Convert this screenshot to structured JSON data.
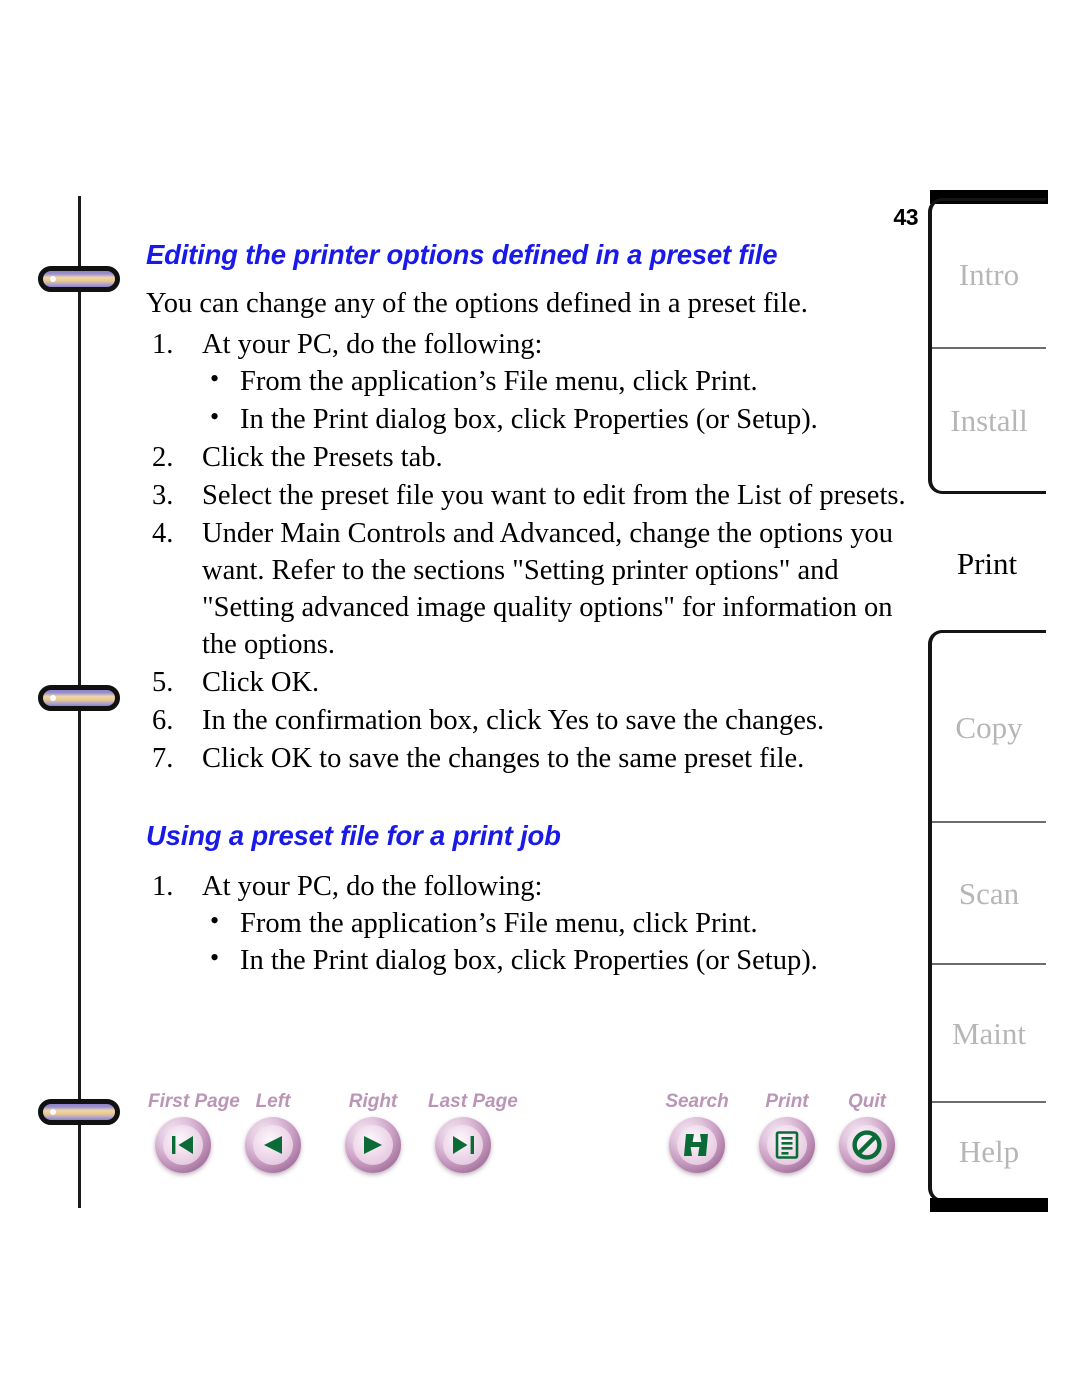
{
  "page": {
    "number": "43"
  },
  "content": {
    "heading_editing": "Editing the printer options defined in a preset file",
    "intro_editing": "You can change any of the options defined in a preset file.",
    "steps_editing": [
      {
        "num": "1.",
        "text": "At your PC, do the following:",
        "substeps": [
          "From the application’s File menu, click Print.",
          "In the Print dialog box, click Properties (or Setup)."
        ]
      },
      {
        "num": "2.",
        "text": "Click the Presets tab.",
        "substeps": []
      },
      {
        "num": "3.",
        "text": "Select the preset file you want to edit from the List of presets.",
        "substeps": []
      },
      {
        "num": "4.",
        "text": "Under Main Controls and Advanced, change the options you want. Refer to the sections \"Setting printer options\" and \"Setting advanced image quality options\" for information on the options.",
        "substeps": []
      },
      {
        "num": "5.",
        "text": "Click OK.",
        "substeps": []
      },
      {
        "num": "6.",
        "text": "In the confirmation box, click Yes to save the changes.",
        "substeps": []
      },
      {
        "num": "7.",
        "text": "Click OK to save the changes to the same preset file.",
        "substeps": []
      }
    ],
    "heading_using": "Using a preset file for a print job",
    "steps_using": [
      {
        "num": "1.",
        "text": "At your PC, do the following:",
        "substeps": [
          "From the application’s File menu, click Print.",
          "In the Print dialog box, click Properties (or Setup)."
        ]
      }
    ],
    "bullet_glyph": "•"
  },
  "nav_buttons": [
    {
      "id": "first-page",
      "label": "First Page",
      "icon": "first-page-icon"
    },
    {
      "id": "left",
      "label": "Left",
      "icon": "previous-page-icon"
    },
    {
      "id": "right",
      "label": "Right",
      "icon": "next-page-icon"
    },
    {
      "id": "last-page",
      "label": "Last Page",
      "icon": "last-page-icon"
    },
    {
      "id": "search",
      "label": "Search",
      "icon": "search-icon"
    },
    {
      "id": "print",
      "label": "Print",
      "icon": "print-document-icon"
    },
    {
      "id": "quit",
      "label": "Quit",
      "icon": "quit-icon"
    }
  ],
  "tabs": [
    {
      "id": "intro",
      "label": "Intro",
      "active": false
    },
    {
      "id": "install",
      "label": "Install",
      "active": false
    },
    {
      "id": "print",
      "label": "Print",
      "active": true
    },
    {
      "id": "copy",
      "label": "Copy",
      "active": false
    },
    {
      "id": "scan",
      "label": "Scan",
      "active": false
    },
    {
      "id": "maint",
      "label": "Maint",
      "active": false
    },
    {
      "id": "help",
      "label": "Help",
      "active": false
    }
  ],
  "colors": {
    "heading_blue": "#1a1ae8",
    "nav_label_mauve": "#bb95b6",
    "nav_icon_green": "#0b6b36",
    "tab_inactive_grey": "#b6b6b6",
    "tab_active_black": "#000000",
    "body_text": "#000000"
  }
}
